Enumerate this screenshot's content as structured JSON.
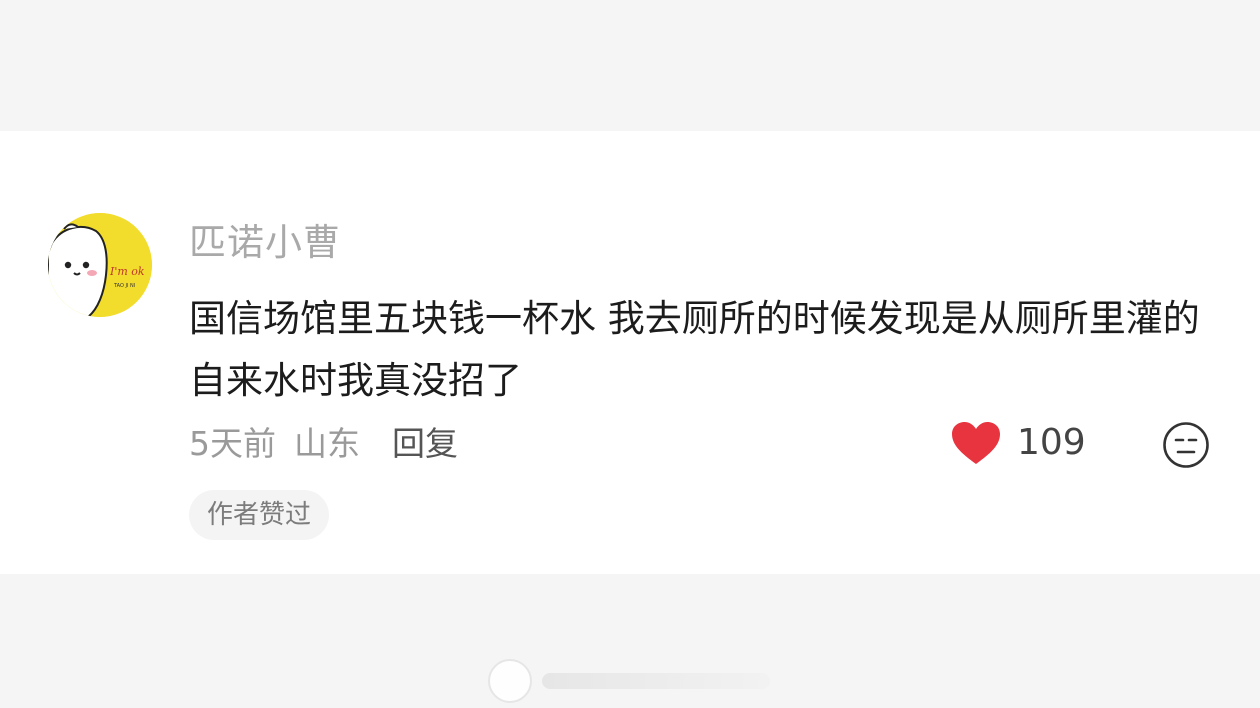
{
  "comment": {
    "username": "匹诺小曹",
    "text": "国信场馆里五块钱一杯水 我去厕所的时候发现是从厕所里灌的自来水时我真没招了",
    "time": "5天前",
    "location": "山东",
    "reply_label": "回复",
    "like_count": "109",
    "badge": "作者赞过",
    "avatar_text": "I'm ok",
    "avatar_subtext": "TAO JI NI"
  },
  "colors": {
    "heart": "#e8343f",
    "avatar_bg": "#f2dc2c"
  },
  "icons": {
    "like": "heart-icon",
    "reaction": "neutral-face-icon"
  }
}
